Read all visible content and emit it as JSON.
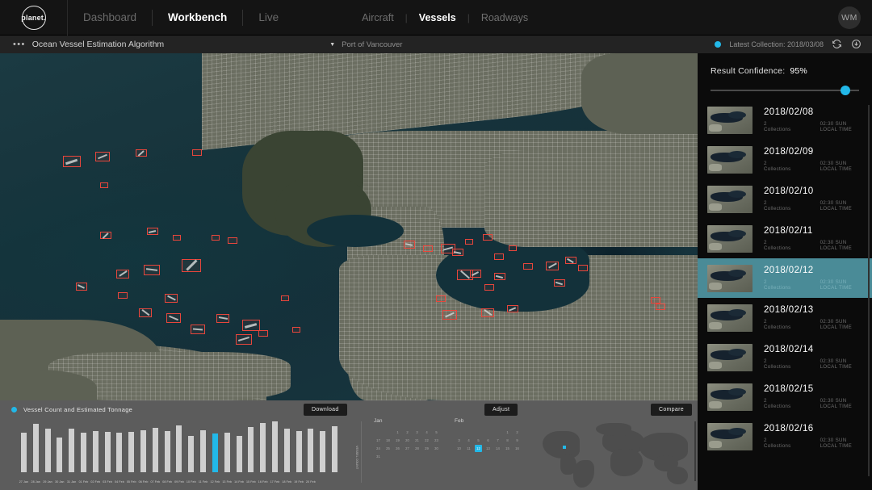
{
  "brand": {
    "logo_text": "planet."
  },
  "topnav": {
    "primary": [
      {
        "label": "Dashboard",
        "active": false
      },
      {
        "label": "Workbench",
        "active": true
      },
      {
        "label": "Live",
        "active": false
      }
    ],
    "secondary": [
      {
        "label": "Aircraft",
        "active": false
      },
      {
        "label": "Vessels",
        "active": true
      },
      {
        "label": "Roadways",
        "active": false
      }
    ],
    "avatar_initials": "WM"
  },
  "toolbar": {
    "menu_dots": "•••",
    "algorithm_name": "Ocean Vessel Estimation Algorithm",
    "aoi_label": "Port of Vancouver",
    "latest_collection": "Latest Collection: 2018/03/08"
  },
  "sidebar": {
    "confidence_label": "Result Confidence:",
    "confidence_value": "95%",
    "confidence_percent": 95,
    "accent_color": "#22b8e8",
    "selected_color": "#4a8b97",
    "dates": [
      {
        "date": "2018/02/08",
        "collections": "2 Collections",
        "time": "02:30 SUN LOCAL TIME",
        "selected": false
      },
      {
        "date": "2018/02/09",
        "collections": "2 Collections",
        "time": "02:30 SUN LOCAL TIME",
        "selected": false
      },
      {
        "date": "2018/02/10",
        "collections": "2 Collections",
        "time": "02:30 SUN LOCAL TIME",
        "selected": false
      },
      {
        "date": "2018/02/11",
        "collections": "2 Collections",
        "time": "02:30 SUN LOCAL TIME",
        "selected": false
      },
      {
        "date": "2018/02/12",
        "collections": "2 Collections",
        "time": "02:30 SUN LOCAL TIME",
        "selected": true
      },
      {
        "date": "2018/02/13",
        "collections": "2 Collections",
        "time": "02:30 SUN LOCAL TIME",
        "selected": false
      },
      {
        "date": "2018/02/14",
        "collections": "2 Collections",
        "time": "02:30 SUN LOCAL TIME",
        "selected": false
      },
      {
        "date": "2018/02/15",
        "collections": "2 Collections",
        "time": "02:30 SUN LOCAL TIME",
        "selected": false
      },
      {
        "date": "2018/02/16",
        "collections": "2 Collections",
        "time": "02:30 SUN LOCAL TIME",
        "selected": false
      }
    ]
  },
  "bottom_panel": {
    "title": "Vessel Count and Estimated Tonnage",
    "download_label": "Download",
    "adjust_label": "Adjust",
    "compare_label": "Compare"
  },
  "chart_data": {
    "type": "bar",
    "title": "Vessel Count and Estimated Tonnage",
    "xlabel": "",
    "ylabel": "VESSEL COUNT",
    "ylim": [
      0,
      100
    ],
    "grid": false,
    "legend": "none",
    "highlight_index": 16,
    "highlight_color": "#22b8e8",
    "bar_color": "#cfcfcf",
    "categories": [
      "27 Jan",
      "28 Jan",
      "29 Jan",
      "30 Jan",
      "31 Jan",
      "01 Feb",
      "02 Feb",
      "03 Feb",
      "04 Feb",
      "05 Feb",
      "06 Feb",
      "07 Feb",
      "08 Feb",
      "09 Feb",
      "10 Feb",
      "11 Feb",
      "12 Feb",
      "13 Feb",
      "14 Feb",
      "15 Feb",
      "16 Feb",
      "17 Feb",
      "18 Feb",
      "19 Feb",
      "20 Feb"
    ],
    "values": [
      72,
      88,
      80,
      63,
      79,
      73,
      75,
      74,
      73,
      74,
      77,
      81,
      76,
      85,
      66,
      77,
      71,
      72,
      67,
      82,
      90,
      93,
      79,
      76,
      80,
      75,
      84
    ]
  },
  "calendars": [
    {
      "month": "Jan",
      "weeks": [
        [
          "",
          "",
          "",
          "",
          "",
          "",
          ""
        ],
        [
          "",
          "",
          "1",
          "2",
          "3",
          "4",
          "5"
        ],
        [
          "6",
          "17",
          "18",
          "19",
          "20",
          "21",
          "22"
        ],
        [
          "23",
          "24",
          "25",
          "26",
          "27",
          "28",
          "29"
        ],
        [
          "30",
          "31",
          "",
          "",
          "",
          "",
          ""
        ]
      ],
      "rows": [
        {
          "days": [
            "",
            "",
            "1",
            "2",
            "3",
            "4",
            "5"
          ]
        },
        {
          "days": [
            "17",
            "18",
            "19",
            "20",
            "21",
            "22",
            "23"
          ]
        },
        {
          "days": [
            "24",
            "25",
            "26",
            "27",
            "28",
            "29",
            "30"
          ]
        },
        {
          "days": [
            "31",
            "",
            "",
            "",
            "",
            "",
            ""
          ]
        }
      ]
    },
    {
      "month": "Feb",
      "rows": [
        {
          "days": [
            "",
            "",
            "",
            "",
            "",
            "1",
            "2"
          ]
        },
        {
          "days": [
            "3",
            "4",
            "5",
            "6",
            "7",
            "8",
            "9"
          ]
        },
        {
          "days": [
            "10",
            "11",
            "12",
            "13",
            "14",
            "15",
            "16"
          ]
        }
      ],
      "selected_day": "12"
    }
  ],
  "map": {
    "detection_box_color": "#e8463c",
    "vessel_count_visible": 48
  }
}
